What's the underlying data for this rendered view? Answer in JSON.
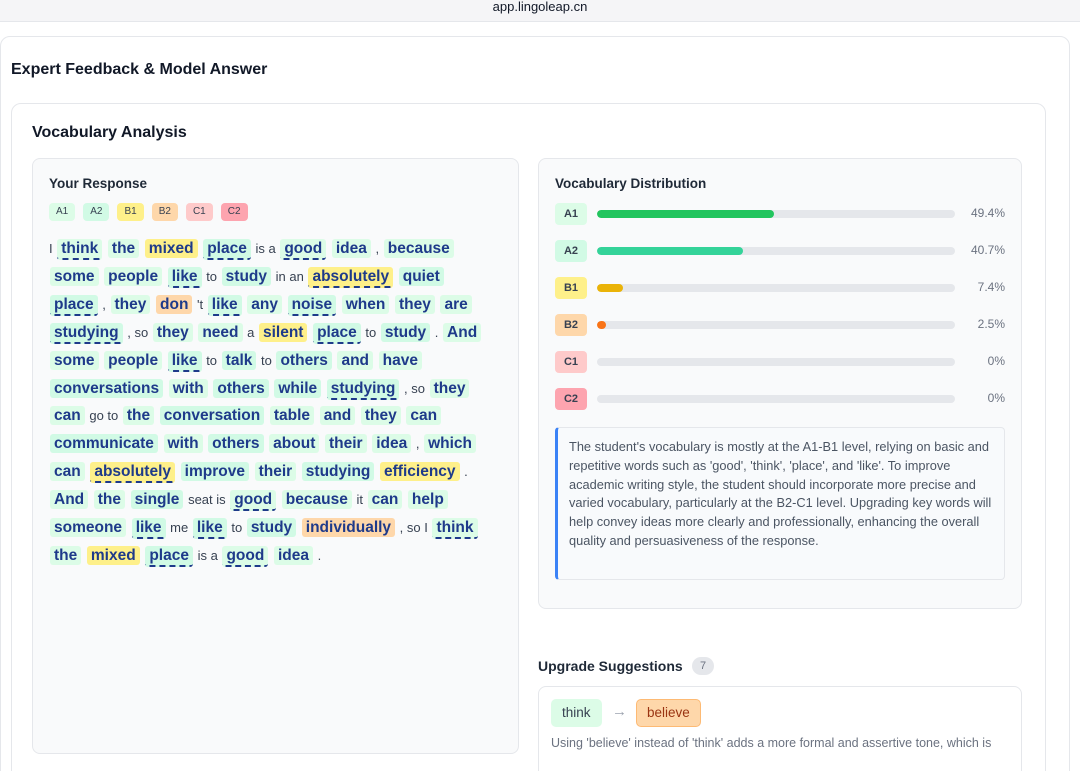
{
  "browser": {
    "url": "app.lingoleap.cn"
  },
  "page_title": "Expert Feedback & Model Answer",
  "section_title": "Vocabulary Analysis",
  "response": {
    "title": "Your Response",
    "legend": [
      "A1",
      "A2",
      "B1",
      "B2",
      "C1",
      "C2"
    ],
    "tokens": [
      {
        "t": "I"
      },
      {
        "w": "think",
        "lv": "A1",
        "dash": true
      },
      {
        "w": "the",
        "lv": "A1"
      },
      {
        "w": "mixed",
        "lv": "B1"
      },
      {
        "w": "place",
        "lv": "A2",
        "dash": true
      },
      {
        "t": "is a"
      },
      {
        "w": "good",
        "lv": "A1",
        "dash": true
      },
      {
        "w": "idea",
        "lv": "A1"
      },
      {
        "t": ","
      },
      {
        "w": "because",
        "lv": "A1"
      },
      {
        "w": "some",
        "lv": "A1"
      },
      {
        "w": "people",
        "lv": "A1"
      },
      {
        "w": "like",
        "lv": "A2",
        "dash": true
      },
      {
        "t": "to"
      },
      {
        "w": "study",
        "lv": "A2"
      },
      {
        "t": "in an"
      },
      {
        "w": "absolutely",
        "lv": "B1",
        "dash": true
      },
      {
        "w": "quiet",
        "lv": "A2"
      },
      {
        "w": "place",
        "lv": "A2",
        "dash": true
      },
      {
        "t": ","
      },
      {
        "w": "they",
        "lv": "A1"
      },
      {
        "w": "don",
        "lv": "B2"
      },
      {
        "t": "'t"
      },
      {
        "w": "like",
        "lv": "A2",
        "dash": true
      },
      {
        "w": "any",
        "lv": "A1"
      },
      {
        "w": "noise",
        "lv": "A2",
        "dash": true
      },
      {
        "w": "when",
        "lv": "A1"
      },
      {
        "w": "they",
        "lv": "A1"
      },
      {
        "w": "are",
        "lv": "A1"
      },
      {
        "w": "studying",
        "lv": "A2",
        "dash": true
      },
      {
        "t": ", so"
      },
      {
        "w": "they",
        "lv": "A1"
      },
      {
        "w": "need",
        "lv": "A1"
      },
      {
        "t": "a"
      },
      {
        "w": "silent",
        "lv": "B1"
      },
      {
        "w": "place",
        "lv": "A2",
        "dash": true
      },
      {
        "t": "to"
      },
      {
        "w": "study",
        "lv": "A2"
      },
      {
        "t": "."
      },
      {
        "w": "And",
        "lv": "A1"
      },
      {
        "w": "some",
        "lv": "A1"
      },
      {
        "w": "people",
        "lv": "A1"
      },
      {
        "w": "like",
        "lv": "A2",
        "dash": true
      },
      {
        "t": "to"
      },
      {
        "w": "talk",
        "lv": "A2"
      },
      {
        "t": "to"
      },
      {
        "w": "others",
        "lv": "A2"
      },
      {
        "w": "and",
        "lv": "A1"
      },
      {
        "w": "have",
        "lv": "A1"
      },
      {
        "w": "conversations",
        "lv": "A2"
      },
      {
        "w": "with",
        "lv": "A1"
      },
      {
        "w": "others",
        "lv": "A2"
      },
      {
        "w": "while",
        "lv": "A2"
      },
      {
        "w": "studying",
        "lv": "A2",
        "dash": true
      },
      {
        "t": ", so"
      },
      {
        "w": "they",
        "lv": "A1"
      },
      {
        "w": "can",
        "lv": "A1"
      },
      {
        "t": "go to"
      },
      {
        "w": "the",
        "lv": "A1"
      },
      {
        "w": "conversation",
        "lv": "A2"
      },
      {
        "w": "table",
        "lv": "A1"
      },
      {
        "w": "and",
        "lv": "A1"
      },
      {
        "w": "they",
        "lv": "A1"
      },
      {
        "w": "can",
        "lv": "A1"
      },
      {
        "w": "communicate",
        "lv": "A2"
      },
      {
        "w": "with",
        "lv": "A1"
      },
      {
        "w": "others",
        "lv": "A2"
      },
      {
        "w": "about",
        "lv": "A1"
      },
      {
        "w": "their",
        "lv": "A1"
      },
      {
        "w": "idea",
        "lv": "A1"
      },
      {
        "t": ","
      },
      {
        "w": "which",
        "lv": "A1"
      },
      {
        "w": "can",
        "lv": "A1"
      },
      {
        "w": "absolutely",
        "lv": "B1",
        "dash": true
      },
      {
        "w": "improve",
        "lv": "A2"
      },
      {
        "w": "their",
        "lv": "A1"
      },
      {
        "w": "studying",
        "lv": "A2"
      },
      {
        "w": "efficiency",
        "lv": "B1"
      },
      {
        "t": "."
      },
      {
        "w": "And",
        "lv": "A1"
      },
      {
        "w": "the",
        "lv": "A1"
      },
      {
        "w": "single",
        "lv": "A2"
      },
      {
        "t": "seat"
      },
      {
        "t": "is"
      },
      {
        "w": "good",
        "lv": "A1",
        "dash": true
      },
      {
        "w": "because",
        "lv": "A1"
      },
      {
        "t": "it"
      },
      {
        "w": "can",
        "lv": "A1"
      },
      {
        "w": "help",
        "lv": "A1"
      },
      {
        "w": "someone",
        "lv": "A1"
      },
      {
        "w": "like",
        "lv": "A2",
        "dash": true
      },
      {
        "t": "me"
      },
      {
        "w": "like",
        "lv": "A2",
        "dash": true
      },
      {
        "t": "to"
      },
      {
        "w": "study",
        "lv": "A2"
      },
      {
        "w": "individually",
        "lv": "B2"
      },
      {
        "t": ", so I"
      },
      {
        "w": "think",
        "lv": "A1",
        "dash": true
      },
      {
        "w": "the",
        "lv": "A1"
      },
      {
        "w": "mixed",
        "lv": "B1"
      },
      {
        "w": "place",
        "lv": "A2",
        "dash": true
      },
      {
        "t": "is a"
      },
      {
        "w": "good",
        "lv": "A1",
        "dash": true
      },
      {
        "w": "idea",
        "lv": "A1"
      },
      {
        "t": "."
      }
    ]
  },
  "distribution": {
    "title": "Vocabulary Distribution",
    "rows": [
      {
        "level": "A1",
        "percent": 49.4,
        "label": "49.4%",
        "color": "#22c55e",
        "badge_bg": "#dcfce7"
      },
      {
        "level": "A2",
        "percent": 40.7,
        "label": "40.7%",
        "color": "#34d399",
        "badge_bg": "#d1fae5"
      },
      {
        "level": "B1",
        "percent": 7.4,
        "label": "7.4%",
        "color": "#eab308",
        "badge_bg": "#fef08a"
      },
      {
        "level": "B2",
        "percent": 2.5,
        "label": "2.5%",
        "color": "#f97316",
        "badge_bg": "#fed7aa"
      },
      {
        "level": "C1",
        "percent": 0,
        "label": "0%",
        "color": "#ef4444",
        "badge_bg": "#fecaca"
      },
      {
        "level": "C2",
        "percent": 0,
        "label": "0%",
        "color": "#e11d48",
        "badge_bg": "#fda4af"
      }
    ],
    "summary": "The student's vocabulary is mostly at the A1-B1 level, relying on basic and repetitive words such as 'good', 'think', 'place', and 'like'. To improve academic writing style, the student should incorporate more precise and varied vocabulary, particularly at the B2-C1 level. Upgrading key words will help convey ideas more clearly and professionally, enhancing the overall quality and persuasiveness of the response."
  },
  "upgrades": {
    "title": "Upgrade Suggestions",
    "count": "7",
    "items": [
      {
        "from": "think",
        "arrow": "→",
        "to": "believe",
        "desc": "Using 'believe' instead of 'think' adds a more formal and assertive tone, which is"
      }
    ]
  }
}
